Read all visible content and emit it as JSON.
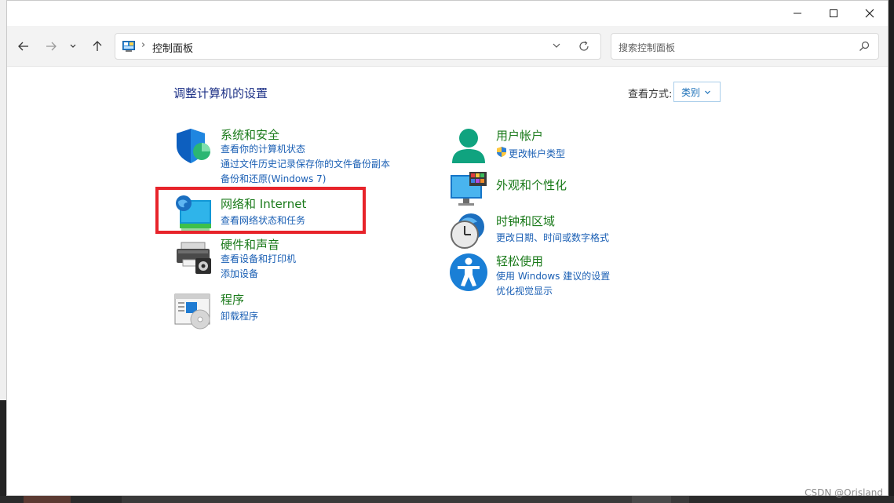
{
  "window": {
    "controls": [
      "minimize",
      "maximize",
      "close"
    ]
  },
  "navbar": {
    "back_icon": "arrow-left-icon",
    "forward_icon": "arrow-right-icon",
    "recent_icon": "chevron-down-icon",
    "up_icon": "arrow-up-icon",
    "address": {
      "icon": "control-panel-icon",
      "separator": "›",
      "path": "控制面板"
    },
    "search": {
      "placeholder": "搜索控制面板"
    }
  },
  "content": {
    "title": "调整计算机的设置",
    "view_label": "查看方式:",
    "view_value": "类别",
    "categories_left": [
      {
        "icon": "shield-icon",
        "title": "系统和安全",
        "links": [
          "查看你的计算机状态",
          "通过文件历史记录保存你的文件备份副本",
          "备份和还原(Windows 7)"
        ]
      },
      {
        "icon": "network-globe-icon",
        "title": "网络和 Internet",
        "links": [
          "查看网络状态和任务"
        ]
      },
      {
        "icon": "printer-icon",
        "title": "硬件和声音",
        "links": [
          "查看设备和打印机",
          "添加设备"
        ]
      },
      {
        "icon": "programs-icon",
        "title": "程序",
        "links": [
          "卸载程序"
        ]
      }
    ],
    "categories_right": [
      {
        "icon": "user-icon",
        "title": "用户帐户",
        "links": [
          "更改帐户类型"
        ]
      },
      {
        "icon": "personalization-monitor-icon",
        "title": "外观和个性化",
        "links": []
      },
      {
        "icon": "clock-globe-icon",
        "title": "时钟和区域",
        "links": [
          "更改日期、时间或数字格式"
        ]
      },
      {
        "icon": "accessibility-icon",
        "title": "轻松使用",
        "links": [
          "使用 Windows 建议的设置",
          "优化视觉显示"
        ]
      }
    ],
    "highlight_target": "网络和 Internet"
  },
  "colors": {
    "title_blue": "#1e3287",
    "category_green": "#1a7a1a",
    "link_blue": "#1a5fb4",
    "highlight_red": "#e7232a"
  },
  "watermark": "CSDN @Orisland"
}
